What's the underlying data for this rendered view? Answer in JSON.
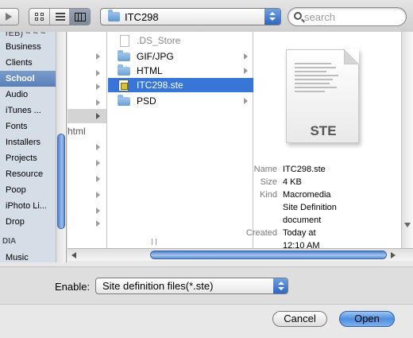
{
  "toolbar": {
    "view_modes": [
      "icon-view",
      "list-view",
      "column-view"
    ],
    "active_view": "column-view",
    "path": "ITC298",
    "search_placeholder": "search"
  },
  "sidebar": {
    "cut_top_item": "rEB) ~ ~ ~",
    "items": [
      {
        "label": "Business"
      },
      {
        "label": "Clients"
      },
      {
        "label": "School",
        "selected": true
      },
      {
        "label": "Audio"
      },
      {
        "label": "iTunes ..."
      },
      {
        "label": "Fonts"
      },
      {
        "label": "Installers"
      },
      {
        "label": "Projects"
      },
      {
        "label": "Resource"
      },
      {
        "label": "Poop"
      },
      {
        "label": "iPhoto Li..."
      },
      {
        "label": "Drop"
      }
    ],
    "section_header": "DIA",
    "bottom_item": "Music"
  },
  "column1": {
    "fragment": "html"
  },
  "column2": {
    "items": [
      {
        "name": ".DS_Store",
        "kind": "document",
        "dim": true
      },
      {
        "name": "GIF/JPG",
        "kind": "folder"
      },
      {
        "name": "HTML",
        "kind": "folder"
      },
      {
        "name": "ITC298.ste",
        "kind": "ste",
        "selected": true
      },
      {
        "name": "PSD",
        "kind": "folder"
      }
    ]
  },
  "preview": {
    "icon_label": "STE",
    "name_key": "Name",
    "name": "ITC298.ste",
    "size_key": "Size",
    "size": "4 KB",
    "kind_key": "Kind",
    "kind_lines": [
      "Macromedia",
      "Site Definition",
      "document"
    ],
    "created_key": "Created",
    "created_lines": [
      "Today at",
      "12:10 AM"
    ]
  },
  "footer": {
    "enable_label": "Enable:",
    "enable_value": "Site definition files(*.ste)",
    "cancel_label": "Cancel",
    "open_label": "Open"
  }
}
